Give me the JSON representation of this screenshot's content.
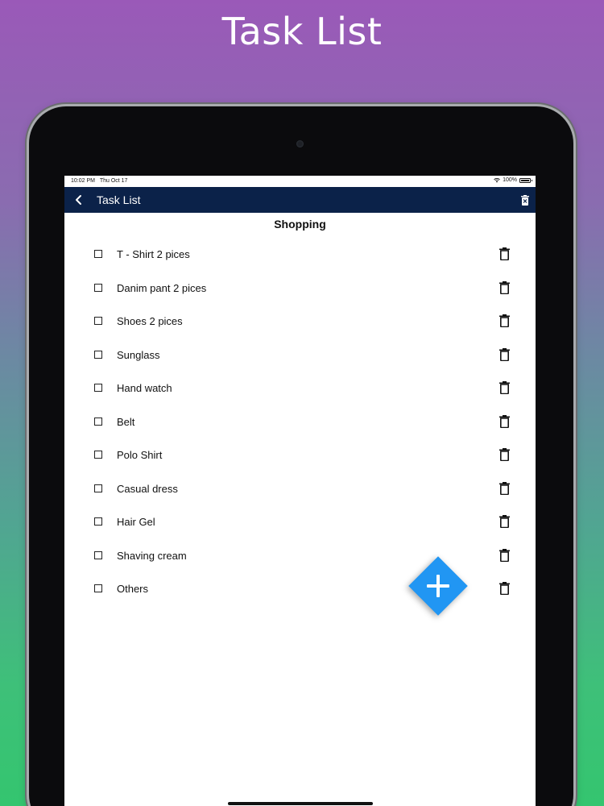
{
  "promo": {
    "title": "Task List"
  },
  "status_bar": {
    "time": "10:02 PM",
    "date": "Thu Oct 17",
    "battery": "100%",
    "battery_level": 1.0
  },
  "nav_bar": {
    "title": "Task List",
    "back_icon": "chevron-left-icon",
    "delete_all_icon": "trash-x-icon",
    "background_color": "#0b2249"
  },
  "list": {
    "title": "Shopping",
    "items": [
      {
        "label": "T - Shirt 2 pices",
        "checked": false
      },
      {
        "label": "Danim pant 2 pices",
        "checked": false
      },
      {
        "label": "Shoes 2 pices",
        "checked": false
      },
      {
        "label": "Sunglass",
        "checked": false
      },
      {
        "label": "Hand watch",
        "checked": false
      },
      {
        "label": "Belt",
        "checked": false
      },
      {
        "label": "Polo Shirt",
        "checked": false
      },
      {
        "label": "Casual dress",
        "checked": false
      },
      {
        "label": "Hair Gel",
        "checked": false
      },
      {
        "label": "Shaving cream",
        "checked": false
      },
      {
        "label": "Others",
        "checked": false
      }
    ],
    "item_delete_icon": "trash-icon"
  },
  "fab": {
    "icon": "plus-icon",
    "color": "#2196f3"
  }
}
